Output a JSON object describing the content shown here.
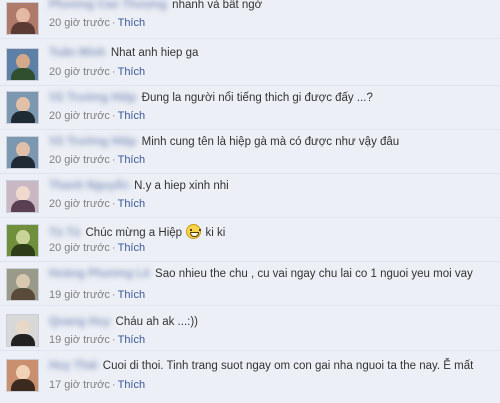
{
  "comments": [
    {
      "author": "Phương Cao Thượng",
      "text": "nhanh và bất ngờ",
      "time": "20 giờ trước",
      "like": "Thích",
      "avatar_color": "#b07a6a",
      "avatar_accent": "#5b3a33"
    },
    {
      "author": "Tuấn Minh",
      "text": "Nhat anh hiep ga",
      "time": "20 giờ trước",
      "like": "Thích",
      "avatar_color": "#5d7fa8",
      "avatar_accent": "#2f4f2f"
    },
    {
      "author": "Vũ Trường Hiệp",
      "text": "Đung la người nổi tiếng thich gi được đấy ...?",
      "time": "20 giờ trước",
      "like": "Thích",
      "avatar_color": "#7c97b0",
      "avatar_accent": "#1f2a35"
    },
    {
      "author": "Vũ Trường Hiệp",
      "text": "Minh cung tên là hiệp gà mà có được như vậy đâu",
      "time": "20 giờ trước",
      "like": "Thích",
      "avatar_color": "#7c97b0",
      "avatar_accent": "#1f2a35"
    },
    {
      "author": "Thanh Nguyễn",
      "text": "N.y a hiep xinh nhi",
      "time": "20 giờ trước",
      "like": "Thích",
      "avatar_color": "#c9b8c4",
      "avatar_accent": "#5a4050"
    },
    {
      "author": "Tú Tú",
      "text_before": "Chúc mừng a Hiệp",
      "text_after": "ki ki",
      "time": "20 giờ trước",
      "like": "Thích",
      "avatar_color": "#6f8f3a",
      "avatar_accent": "#2d3d1a"
    },
    {
      "author": "Hoàng Phương Lê",
      "text": "Sao nhieu the chu , cu vai ngay chu lai co 1 nguoi yeu moi vay",
      "time": "19 giờ trước",
      "like": "Thích",
      "avatar_color": "#9a9a8a",
      "avatar_accent": "#5a4a3a"
    },
    {
      "author": "Quang Huy",
      "text": "Cháu ah ak ...:))",
      "time": "19 giờ trước",
      "like": "Thích",
      "avatar_color": "#d8d8d8",
      "avatar_accent": "#222222"
    },
    {
      "author": "Huy Thái",
      "text": "Cuoi di thoi. Tinh trang suot ngay om con gai nha nguoi ta the nay. Ễ mất",
      "time": "17 giờ trước",
      "like": "Thích",
      "avatar_color": "#c98f6e",
      "avatar_accent": "#3a2a20"
    }
  ],
  "separator": "·"
}
